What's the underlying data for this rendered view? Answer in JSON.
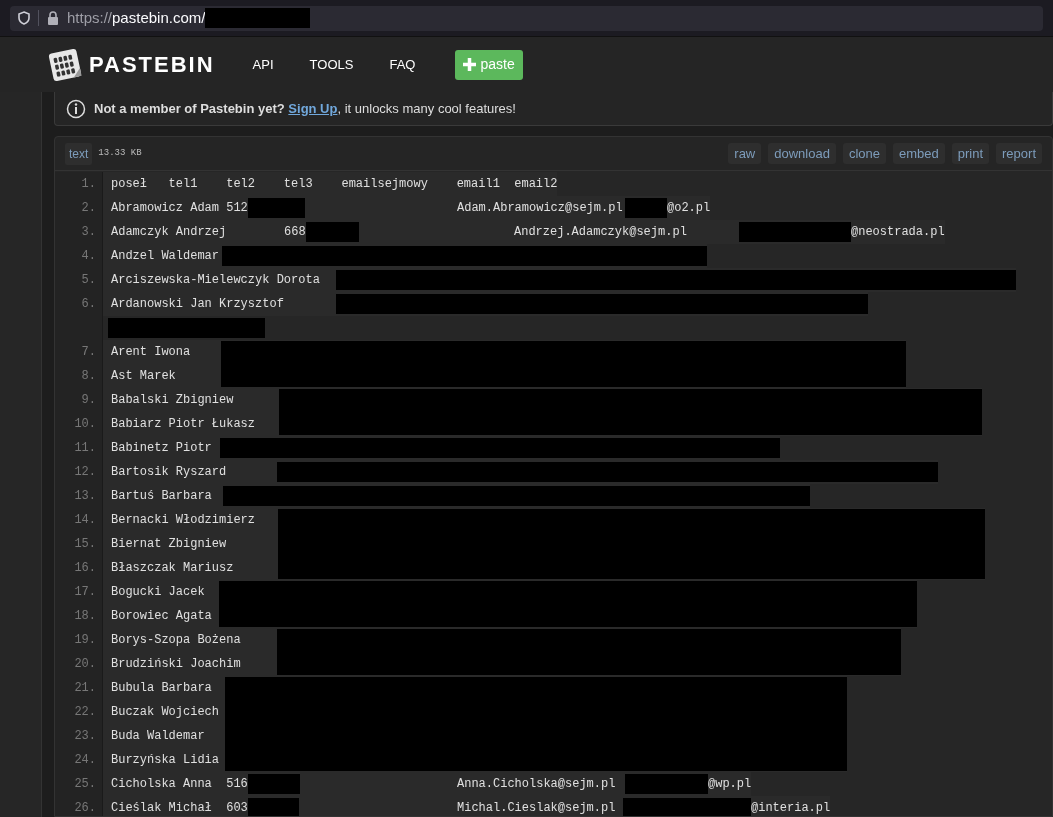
{
  "browser": {
    "url_scheme": "https://",
    "url_host": "pastebin.com/",
    "url_path_redacted": true
  },
  "header": {
    "logo_text": "PASTEBIN",
    "nav": [
      "API",
      "TOOLS",
      "FAQ"
    ],
    "paste_button": "paste"
  },
  "notice": {
    "bold": "Not a member of Pastebin yet?",
    "link": "Sign Up",
    "rest": ", it unlocks many cool features!"
  },
  "paste": {
    "syntax": "text",
    "size": "13.33 KB",
    "actions": [
      "raw",
      "download",
      "clone",
      "embed",
      "print",
      "report"
    ],
    "lines": [
      {
        "number": "1.",
        "segments": [
          {
            "kind": "text",
            "text": "poseł   tel1    tel2    tel3    emailsejmowy    email1  email2"
          }
        ]
      },
      {
        "number": "2.",
        "segments": [
          {
            "kind": "text",
            "text": "Abramowicz Adam 512"
          },
          {
            "kind": "redacted"
          },
          {
            "kind": "text",
            "text": "Adam.Abramowicz@sejm.pl"
          },
          {
            "kind": "redacted"
          },
          {
            "kind": "text",
            "text": "@o2.pl"
          }
        ]
      },
      {
        "number": "3.",
        "segments": [
          {
            "kind": "text",
            "text": "Adamczyk Andrzej"
          },
          {
            "kind": "text",
            "text": "668"
          },
          {
            "kind": "redacted"
          },
          {
            "kind": "text",
            "text": "Andrzej.Adamczyk@sejm.pl"
          },
          {
            "kind": "redacted"
          },
          {
            "kind": "text",
            "text": "@neostrada.pl"
          }
        ]
      },
      {
        "number": "4.",
        "segments": [
          {
            "kind": "text",
            "text": "Andzel Waldemar"
          },
          {
            "kind": "redacted"
          }
        ]
      },
      {
        "number": "5.",
        "segments": [
          {
            "kind": "text",
            "text": "Arciszewska-Mielewczyk Dorota"
          },
          {
            "kind": "redacted"
          }
        ]
      },
      {
        "number": "6.",
        "segments": [
          {
            "kind": "text",
            "text": "Ardanowski Jan Krzysztof"
          },
          {
            "kind": "redacted"
          }
        ],
        "continuation": [
          {
            "kind": "redacted"
          }
        ]
      },
      {
        "number": "7.",
        "segments": [
          {
            "kind": "text",
            "text": "Arent Iwona"
          },
          {
            "kind": "redacted"
          }
        ]
      },
      {
        "number": "8.",
        "segments": [
          {
            "kind": "text",
            "text": "Ast Marek"
          },
          {
            "kind": "redacted"
          }
        ]
      },
      {
        "number": "9.",
        "segments": [
          {
            "kind": "text",
            "text": "Babalski Zbigniew"
          },
          {
            "kind": "redacted"
          }
        ]
      },
      {
        "number": "10.",
        "segments": [
          {
            "kind": "text",
            "text": "Babiarz Piotr Łukasz"
          },
          {
            "kind": "redacted"
          }
        ]
      },
      {
        "number": "11.",
        "segments": [
          {
            "kind": "text",
            "text": "Babinetz Piotr"
          },
          {
            "kind": "redacted"
          }
        ]
      },
      {
        "number": "12.",
        "segments": [
          {
            "kind": "text",
            "text": "Bartosik Ryszard"
          },
          {
            "kind": "redacted"
          }
        ]
      },
      {
        "number": "13.",
        "segments": [
          {
            "kind": "text",
            "text": "Bartuś Barbara"
          },
          {
            "kind": "redacted"
          }
        ]
      },
      {
        "number": "14.",
        "segments": [
          {
            "kind": "text",
            "text": "Bernacki Włodzimierz"
          },
          {
            "kind": "redacted"
          }
        ]
      },
      {
        "number": "15.",
        "segments": [
          {
            "kind": "text",
            "text": "Biernat Zbigniew"
          },
          {
            "kind": "redacted"
          }
        ]
      },
      {
        "number": "16.",
        "segments": [
          {
            "kind": "text",
            "text": "Błaszczak Mariusz"
          },
          {
            "kind": "redacted"
          }
        ]
      },
      {
        "number": "17.",
        "segments": [
          {
            "kind": "text",
            "text": "Bogucki Jacek"
          },
          {
            "kind": "redacted"
          }
        ]
      },
      {
        "number": "18.",
        "segments": [
          {
            "kind": "text",
            "text": "Borowiec Agata"
          },
          {
            "kind": "redacted"
          }
        ]
      },
      {
        "number": "19.",
        "segments": [
          {
            "kind": "text",
            "text": "Borys-Szopa Bożena"
          },
          {
            "kind": "redacted"
          }
        ]
      },
      {
        "number": "20.",
        "segments": [
          {
            "kind": "text",
            "text": "Brudziński Joachim"
          },
          {
            "kind": "redacted"
          }
        ]
      },
      {
        "number": "21.",
        "segments": [
          {
            "kind": "text",
            "text": "Bubula Barbara"
          },
          {
            "kind": "redacted"
          }
        ]
      },
      {
        "number": "22.",
        "segments": [
          {
            "kind": "text",
            "text": "Buczak Wojciech"
          },
          {
            "kind": "redacted"
          }
        ]
      },
      {
        "number": "23.",
        "segments": [
          {
            "kind": "text",
            "text": "Buda Waldemar"
          },
          {
            "kind": "redacted"
          }
        ]
      },
      {
        "number": "24.",
        "segments": [
          {
            "kind": "text",
            "text": "Burzyńska Lidia"
          },
          {
            "kind": "redacted"
          }
        ]
      },
      {
        "number": "25.",
        "segments": [
          {
            "kind": "text",
            "text": "Cicholska Anna  516"
          },
          {
            "kind": "redacted"
          },
          {
            "kind": "text",
            "text": "Anna.Cicholska@sejm.pl"
          },
          {
            "kind": "redacted"
          },
          {
            "kind": "text",
            "text": "@wp.pl"
          }
        ]
      },
      {
        "number": "26.",
        "segments": [
          {
            "kind": "text",
            "text": "Cieślak Michał  603"
          },
          {
            "kind": "redacted"
          },
          {
            "kind": "text",
            "text": "Michal.Cieslak@sejm.pl"
          },
          {
            "kind": "redacted"
          },
          {
            "kind": "text",
            "text": "@interia.pl"
          }
        ]
      }
    ]
  }
}
